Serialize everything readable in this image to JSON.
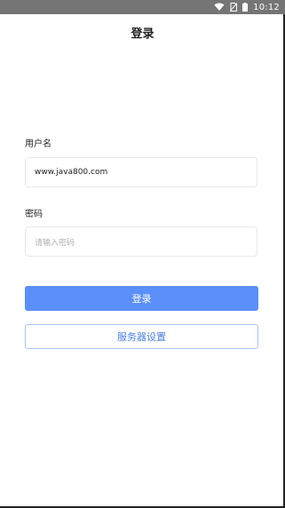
{
  "status_bar": {
    "time": "10:12",
    "icons": [
      "wifi-icon",
      "no-sim-icon",
      "battery-icon"
    ]
  },
  "header": {
    "title": "登录"
  },
  "form": {
    "username_label": "用户名",
    "username_value": "www.java800.com",
    "password_label": "密码",
    "password_placeholder": "请输入密码"
  },
  "buttons": {
    "login": "登录",
    "server_settings": "服务器设置"
  },
  "colors": {
    "status_bar": "#757575",
    "primary": "#5b8ff9",
    "secondary_border": "#a9c4f5",
    "secondary_text": "#4a80e8"
  }
}
